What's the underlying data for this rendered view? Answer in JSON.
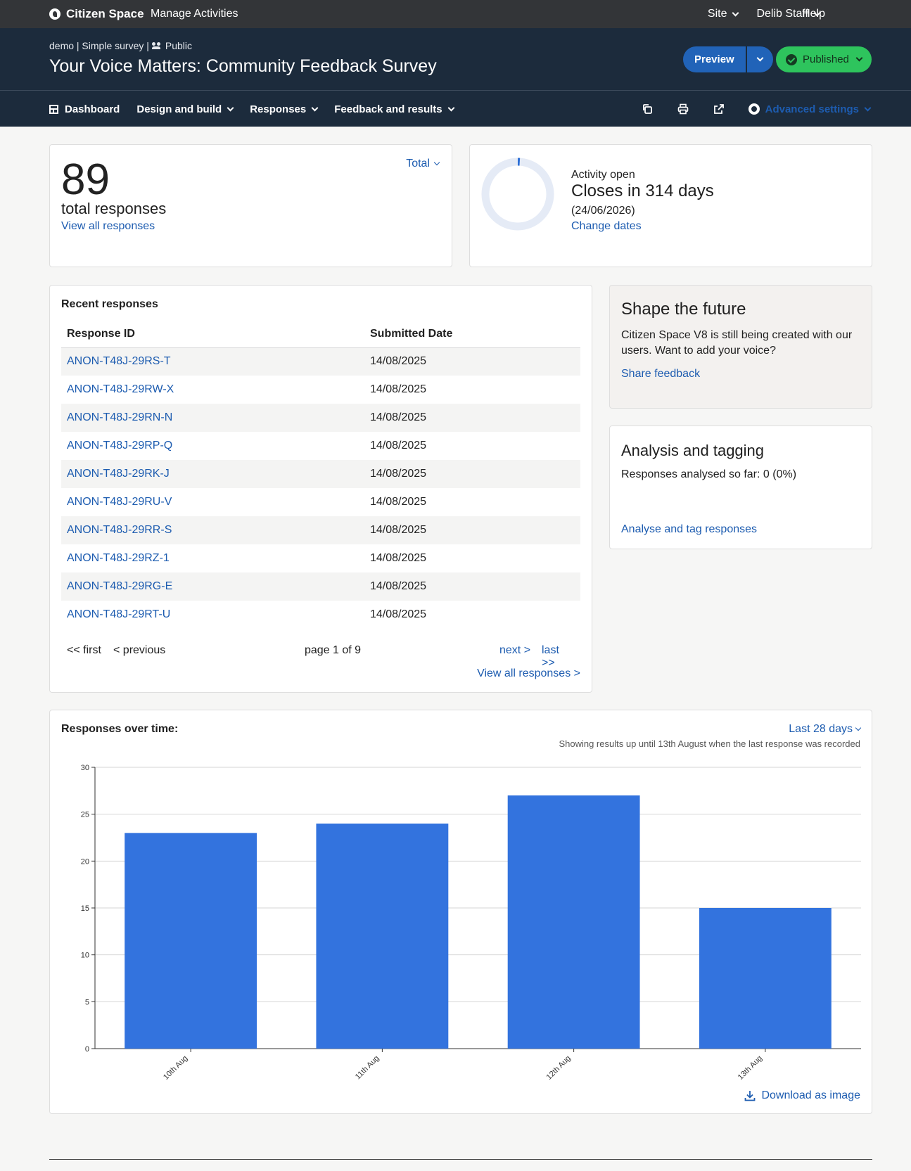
{
  "topbar": {
    "brand": "Citizen Space",
    "manage": "Manage Activities",
    "site": "Site",
    "user": "Delib Staff",
    "help": "Help"
  },
  "header": {
    "crumb_demo": "demo | Simple survey |",
    "crumb_public": "Public",
    "title": "Your Voice Matters: Community Feedback Survey",
    "preview": "Preview",
    "status": "Published",
    "status_color": "#2ec45d"
  },
  "nav": {
    "dashboard": "Dashboard",
    "design": "Design and build",
    "responses": "Responses",
    "feedback": "Feedback and results",
    "advanced": "Advanced settings"
  },
  "total": {
    "count": "89",
    "label": "total responses",
    "view_all": "View all responses",
    "filter": "Total"
  },
  "activity": {
    "status": "Activity open",
    "closes": "Closes in 314 days",
    "date": "(24/06/2026)",
    "change": "Change dates",
    "elapsed_fraction": 0.01
  },
  "recent": {
    "title": "Recent responses",
    "col_id": "Response ID",
    "col_date": "Submitted Date",
    "rows": [
      {
        "id": "ANON-T48J-29RS-T",
        "date": "14/08/2025"
      },
      {
        "id": "ANON-T48J-29RW-X",
        "date": "14/08/2025"
      },
      {
        "id": "ANON-T48J-29RN-N",
        "date": "14/08/2025"
      },
      {
        "id": "ANON-T48J-29RP-Q",
        "date": "14/08/2025"
      },
      {
        "id": "ANON-T48J-29RK-J",
        "date": "14/08/2025"
      },
      {
        "id": "ANON-T48J-29RU-V",
        "date": "14/08/2025"
      },
      {
        "id": "ANON-T48J-29RR-S",
        "date": "14/08/2025"
      },
      {
        "id": "ANON-T48J-29RZ-1",
        "date": "14/08/2025"
      },
      {
        "id": "ANON-T48J-29RG-E",
        "date": "14/08/2025"
      },
      {
        "id": "ANON-T48J-29RT-U",
        "date": "14/08/2025"
      }
    ],
    "first": "<< first",
    "previous": "< previous",
    "page": "page 1 of 9",
    "next": "next >",
    "last": "last >>",
    "view_all": "View all responses >"
  },
  "shape": {
    "title": "Shape the future",
    "text": "Citizen Space V8 is still being created with our users. Want to add your voice?",
    "link": "Share feedback"
  },
  "analysis": {
    "title": "Analysis and tagging",
    "text": "Responses analysed so far: 0 (0%)",
    "link": "Analyse and tag responses"
  },
  "chart": {
    "title": "Responses over time:",
    "range": "Last 28 days",
    "note": "Showing results up until 13th August when the last response was recorded",
    "download": "Download as image"
  },
  "chart_data": {
    "type": "bar",
    "categories": [
      "10th Aug",
      "11th Aug",
      "12th Aug",
      "13th Aug"
    ],
    "values": [
      23,
      24,
      27,
      15
    ],
    "ylim": [
      0,
      30
    ],
    "yticks": [
      0,
      5,
      10,
      15,
      20,
      25,
      30
    ],
    "grid": true,
    "color": "#3373de"
  }
}
